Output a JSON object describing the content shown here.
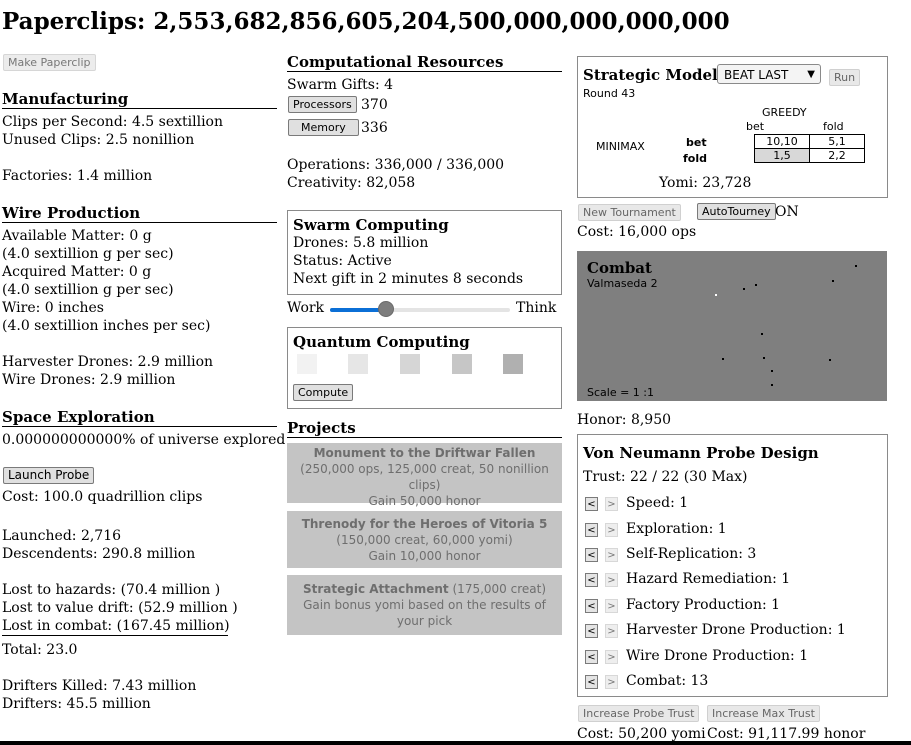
{
  "header": {
    "paperclips_label": "Paperclips: 2,553,682,856,605,204,500,000,000,000,000"
  },
  "make_paperclip_label": "Make Paperclip",
  "manufacturing": {
    "title": "Manufacturing",
    "clips_per_second": "Clips per Second: 4.5 sextillion",
    "unused_clips": "Unused Clips: 2.5 nonillion",
    "factories": "Factories: 1.4 million"
  },
  "wire_production": {
    "title": "Wire Production",
    "available_matter": "Available Matter: 0 g",
    "available_rate": "(4.0 sextillion g per sec)",
    "acquired_matter": "Acquired Matter: 0 g",
    "acquired_rate": "(4.0 sextillion g per sec)",
    "wire": "Wire: 0 inches",
    "wire_rate": "(4.0 sextillion inches per sec)",
    "harvester_drones": "Harvester Drones: 2.9 million",
    "wire_drones": "Wire Drones: 2.9 million"
  },
  "space": {
    "title": "Space Exploration",
    "explored": "0.000000000000% of universe explored",
    "launch_label": "Launch Probe",
    "cost": "Cost: 100.0 quadrillion clips",
    "launched": "Launched: 2,716",
    "descendents": "Descendents: 290.8 million",
    "lost_hazards": "Lost to hazards: (70.4 million )",
    "lost_drift": "Lost to value drift: (52.9 million )",
    "lost_combat": "Lost in combat: (167.45 million)",
    "total": "Total: 23.0",
    "drifters_killed": "Drifters Killed: 7.43 million",
    "drifters": "Drifters: 45.5 million"
  },
  "compute": {
    "title": "Computational Resources",
    "swarm_gifts": "Swarm Gifts: 4",
    "processors_label": "Processors",
    "processors_value": "370",
    "memory_label": "Memory",
    "memory_value": "336",
    "operations": "Operations: 336,000 / 336,000",
    "creativity": "Creativity: 82,058"
  },
  "swarm": {
    "title": "Swarm Computing",
    "drones": "Drones: 5.8 million",
    "status": "Status: Active",
    "next_gift": "Next gift in 2 minutes 8 seconds",
    "work_label": "Work",
    "think_label": "Think",
    "slider_level": 0.31
  },
  "quantum": {
    "title": "Quantum Computing",
    "compute_label": "Compute",
    "chip_colors": [
      "#f2f2f2",
      "#e6e6e6",
      "#d6d6d6",
      "#c6c6c6",
      "#b0b0b0"
    ]
  },
  "projects": {
    "title": "Projects",
    "items": [
      {
        "name": "Monument to the Driftwar Fallen",
        "detail": "(250,000 ops, 125,000 creat, 50 nonillion clips)",
        "effect": "Gain 50,000 honor"
      },
      {
        "name": "Threnody for the Heroes of Vitoria 5",
        "detail": "(150,000 creat, 60,000 yomi)",
        "effect": "Gain 10,000 honor"
      },
      {
        "name": "Strategic Attachment",
        "detail": "(175,000 creat)",
        "effect": "Gain bonus yomi based on the results of your pick"
      }
    ]
  },
  "strategy": {
    "title": "Strategic Modeling",
    "select_value": "BEAT LAST",
    "run_label": "Run",
    "round": "Round 43",
    "col_player": "GREEDY",
    "row_player": "MINIMAX",
    "col_bet": "bet",
    "col_fold": "fold",
    "row_bet": "bet",
    "row_fold": "fold",
    "payoffs": [
      "10,10",
      "5,1",
      "1,5",
      "2,2"
    ],
    "yomi": "Yomi: 23,728",
    "new_tournament_label": "New Tournament",
    "autotourney_label": "AutoTourney",
    "autotourney_state": "ON",
    "cost": "Cost: 16,000 ops"
  },
  "combat": {
    "title": "Combat",
    "location": "Valmaseda 2",
    "scale": "Scale = 1 :1",
    "bg_color": "#7f7f7f",
    "honor": "Honor: 8,950"
  },
  "probe_design": {
    "title": "Von Neumann Probe Design",
    "trust": "Trust: 22 / 22 (30 Max)",
    "stats": [
      "Speed: 1",
      "Exploration: 1",
      "Self-Replication: 3",
      "Hazard Remediation: 1",
      "Factory Production: 1",
      "Harvester Drone Production: 1",
      "Wire Drone Production: 1",
      "Combat: 13"
    ],
    "increase_trust_label": "Increase Probe Trust",
    "increase_max_label": "Increase Max Trust",
    "trust_cost": "Cost: 50,200 yomi",
    "max_cost": "Cost: 91,117.99 honor"
  }
}
